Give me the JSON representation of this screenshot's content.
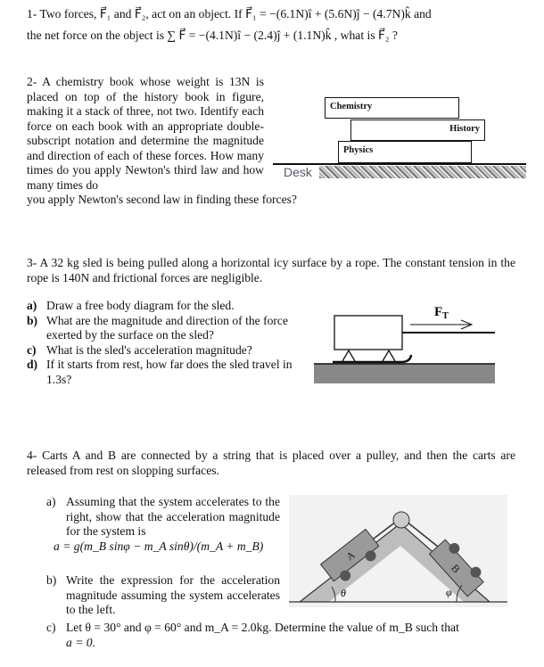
{
  "p1": {
    "line1": "1- Two forces, F⃗₁ and F⃗₂, act on an object. If F⃗₁ = −(6.1N)î + (5.6N)ĵ − (4.7N)k̂  and",
    "line2": "the net force on the object is ∑ F⃗ = −(4.1N)î − (2.4)ĵ + (1.1N)k̂ ,  what is F⃗₂ ?"
  },
  "p2": {
    "text": "2- A chemistry book whose weight is 13N is placed on top of the history book in figure, making it a stack of three, not two. Identify each force on each book with an appropriate double-subscript notation and determine the magnitude and direction of each of these forces. How many times do you apply Newton's third law and how many times do",
    "last": "you apply Newton's second law in finding these forces?",
    "books": [
      "Chemistry",
      "History",
      "Physics"
    ],
    "desk": "Desk"
  },
  "p3": {
    "text": "3- A 32 kg sled is being pulled along a horizontal icy surface by a rope. The constant tension in the rope is 140N and frictional forces are negligible.",
    "items": [
      {
        "label": "a)",
        "text": "Draw a free body diagram for the sled."
      },
      {
        "label": "b)",
        "text": "What are the magnitude and direction of the force exerted by the surface on the sled?"
      },
      {
        "label": "c)",
        "text": "What is the sled's acceleration magnitude?"
      },
      {
        "label": "d)",
        "text": "If it starts from rest, how far does the sled travel in 1.3s?"
      }
    ],
    "force_label": "F",
    "force_sub": "T"
  },
  "p4": {
    "text": "4- Carts A and B are connected by a string that is placed over a pulley, and then the carts are released from rest on slopping surfaces.",
    "a_label": "a)",
    "a_text": "Assuming that the system accelerates to the right, show that the acceleration magnitude for the system is",
    "a_eq": "a = g(m_B sinφ − m_A sinθ)/(m_A + m_B)",
    "b_label": "b)",
    "b_text": "Write the expression for the acceleration magnitude assuming the system accelerates to the left.",
    "c_label": "c)",
    "c_text": "Let θ = 30° and φ = 60° and m_A = 2.0kg. Determine the value of m_B such that",
    "c_text2": "a = 0.",
    "cart_a": "A",
    "cart_b": "B",
    "theta": "θ",
    "phi": "φ"
  }
}
